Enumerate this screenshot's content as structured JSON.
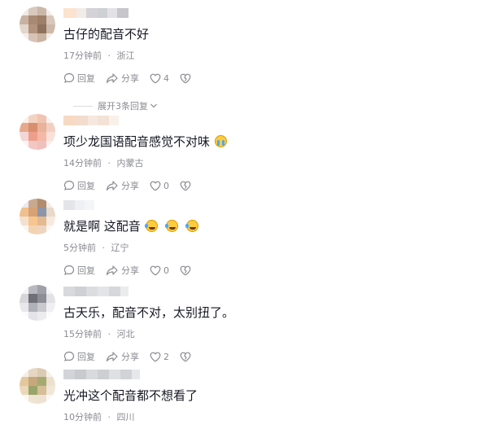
{
  "comments": [
    {
      "text": "古仔的配音不好",
      "time": "17分钟前",
      "location": "浙江",
      "reply_label": "回复",
      "share_label": "分享",
      "likes": "4",
      "emojis": []
    },
    {
      "text": "项少龙国语配音感觉不对味",
      "time": "14分钟前",
      "location": "内蒙古",
      "reply_label": "回复",
      "share_label": "分享",
      "likes": "0",
      "emojis": [
        "cry-face-emoji"
      ]
    },
    {
      "text": "就是啊 这配音",
      "time": "5分钟前",
      "location": "辽宁",
      "reply_label": "回复",
      "share_label": "分享",
      "likes": "0",
      "emojis": [
        "laugh-cry-emoji",
        "laugh-cry-emoji",
        "laugh-cry-emoji"
      ]
    },
    {
      "text": "古天乐，配音不对，太别扭了。",
      "time": "15分钟前",
      "location": "河北",
      "reply_label": "回复",
      "share_label": "分享",
      "likes": "2",
      "emojis": []
    },
    {
      "text": "光冲这个配音都不想看了",
      "time": "10分钟前",
      "location": "四川",
      "reply_label": "回复",
      "share_label": "分享",
      "likes": "",
      "emojis": []
    }
  ],
  "expand_replies_label": "展开3条回复",
  "separator": "·",
  "colors": {
    "text": "#161823",
    "meta": "#8a8b91",
    "background": "#ffffff"
  },
  "icons": {
    "reply": "reply-bubble-icon",
    "share": "share-arrow-icon",
    "like": "heart-icon",
    "dislike": "broken-heart-icon",
    "expand": "chevron-down-icon"
  }
}
